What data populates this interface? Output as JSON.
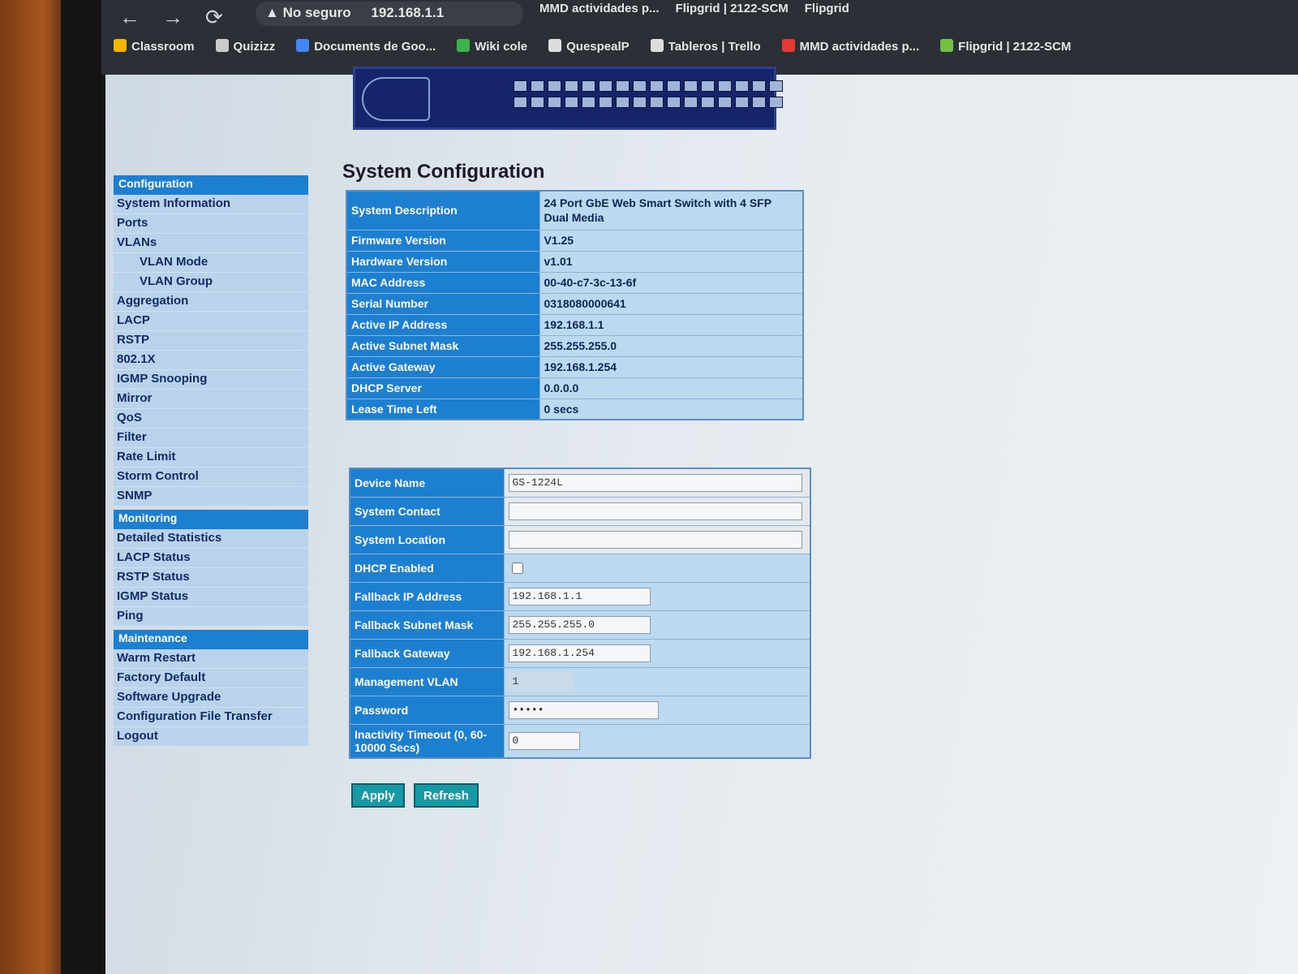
{
  "browser": {
    "security_label": "No seguro",
    "url": "192.168.1.1",
    "tabs": [
      "MMD actividades p...",
      "Flipgrid | 2122-SCM",
      "Flipgrid"
    ],
    "bookmarks": [
      {
        "label": "Classroom",
        "color": "#f3b500"
      },
      {
        "label": "Quizizz",
        "color": "#cccccc"
      },
      {
        "label": "Documents de Goo...",
        "color": "#4285f4"
      },
      {
        "label": "Wiki cole",
        "color": "#3bb54a"
      },
      {
        "label": "QuespealP",
        "color": "#dddddd"
      },
      {
        "label": "Tableros | Trello",
        "color": "#dddddd"
      },
      {
        "label": "MMD actividades p...",
        "color": "#e53935"
      },
      {
        "label": "Flipgrid | 2122-SCM",
        "color": "#74c043"
      }
    ]
  },
  "page_title": "System Configuration",
  "sidebar": {
    "sections": [
      {
        "header": "Configuration",
        "items": [
          {
            "label": "System Information",
            "sub": false
          },
          {
            "label": "Ports",
            "sub": false
          },
          {
            "label": "VLANs",
            "sub": false
          },
          {
            "label": "VLAN Mode",
            "sub": true
          },
          {
            "label": "VLAN Group",
            "sub": true
          },
          {
            "label": "Aggregation",
            "sub": false
          },
          {
            "label": "LACP",
            "sub": false
          },
          {
            "label": "RSTP",
            "sub": false
          },
          {
            "label": "802.1X",
            "sub": false
          },
          {
            "label": "IGMP Snooping",
            "sub": false
          },
          {
            "label": "Mirror",
            "sub": false
          },
          {
            "label": "QoS",
            "sub": false
          },
          {
            "label": "Filter",
            "sub": false
          },
          {
            "label": "Rate Limit",
            "sub": false
          },
          {
            "label": "Storm Control",
            "sub": false
          },
          {
            "label": "SNMP",
            "sub": false
          }
        ]
      },
      {
        "header": "Monitoring",
        "items": [
          {
            "label": "Detailed Statistics",
            "sub": false
          },
          {
            "label": "LACP Status",
            "sub": false
          },
          {
            "label": "RSTP Status",
            "sub": false
          },
          {
            "label": "IGMP Status",
            "sub": false
          },
          {
            "label": "Ping",
            "sub": false
          }
        ]
      },
      {
        "header": "Maintenance",
        "items": [
          {
            "label": "Warm Restart",
            "sub": false
          },
          {
            "label": "Factory Default",
            "sub": false
          },
          {
            "label": "Software Upgrade",
            "sub": false
          },
          {
            "label": "Configuration File Transfer",
            "sub": false
          },
          {
            "label": "Logout",
            "sub": false
          }
        ]
      }
    ]
  },
  "system_info": [
    {
      "label": "System Description",
      "value": "24 Port GbE Web Smart Switch with 4 SFP Dual Media"
    },
    {
      "label": "Firmware Version",
      "value": "V1.25"
    },
    {
      "label": "Hardware Version",
      "value": "v1.01"
    },
    {
      "label": "MAC Address",
      "value": "00-40-c7-3c-13-6f"
    },
    {
      "label": "Serial Number",
      "value": "0318080000641"
    },
    {
      "label": "Active IP Address",
      "value": "192.168.1.1"
    },
    {
      "label": "Active Subnet Mask",
      "value": "255.255.255.0"
    },
    {
      "label": "Active Gateway",
      "value": "192.168.1.254"
    },
    {
      "label": "DHCP Server",
      "value": "0.0.0.0"
    },
    {
      "label": "Lease Time Left",
      "value": "0 secs"
    }
  ],
  "settings": {
    "device_name": {
      "label": "Device Name",
      "value": "GS-1224L"
    },
    "system_contact": {
      "label": "System Contact",
      "value": ""
    },
    "system_location": {
      "label": "System Location",
      "value": ""
    },
    "dhcp_enabled": {
      "label": "DHCP Enabled",
      "checked": false
    },
    "fallback_ip": {
      "label": "Fallback IP Address",
      "value": "192.168.1.1"
    },
    "fallback_mask": {
      "label": "Fallback Subnet Mask",
      "value": "255.255.255.0"
    },
    "fallback_gateway": {
      "label": "Fallback Gateway",
      "value": "192.168.1.254"
    },
    "management_vlan": {
      "label": "Management VLAN",
      "value": "1"
    },
    "password": {
      "label": "Password",
      "value": "•••••"
    },
    "inactivity_timeout": {
      "label": "Inactivity Timeout (0, 60-10000 Secs)",
      "value": "0"
    }
  },
  "buttons": {
    "apply": "Apply",
    "refresh": "Refresh"
  }
}
